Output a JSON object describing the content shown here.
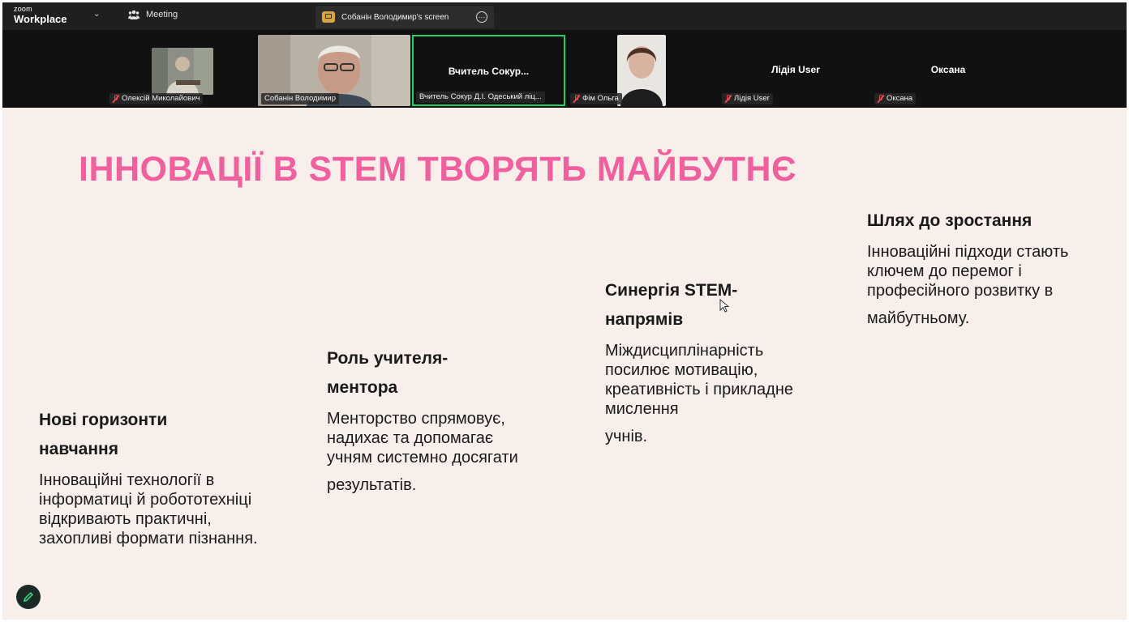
{
  "app": {
    "logo_top": "zoom",
    "logo_bottom": "Workplace",
    "meeting_label": "Meeting",
    "screen_tab_label": "Собанін Володимир's screen"
  },
  "participants": [
    {
      "name": "Олексій Миколайович",
      "muted": true,
      "has_video": true
    },
    {
      "name": "Собанін Володимир",
      "muted": false,
      "has_video": true
    },
    {
      "name": "Вчитель Сокур Д.І. Одеський ліц...",
      "center_name": "Вчитель  Сокур...",
      "muted": false,
      "has_video": false,
      "active_speaker": true
    },
    {
      "name": "Фім Ольга",
      "muted": true,
      "has_video": true
    },
    {
      "name": "Лідія User",
      "center_name": "Лідія User",
      "muted": true,
      "has_video": false
    },
    {
      "name": "Оксана",
      "center_name": "Оксана",
      "muted": true,
      "has_video": false
    }
  ],
  "slide": {
    "title": "ІННОВАЦІЇ В STEM ТВОРЯТЬ МАЙБУТНЄ",
    "columns": [
      {
        "heading_1": "Нові горизонти",
        "heading_2": "навчання",
        "body": "Інноваційні технології в інформатиці й робототехніці відкривають практичні, захопливі формати пізнання."
      },
      {
        "heading_1": "Роль учителя-",
        "heading_2": "ментора",
        "body": "Менторство спрямовує, надихає та допомагає учням системно досягати",
        "body_last": "результатів."
      },
      {
        "heading_1": "Синергія STEM-",
        "heading_2": "напрямів",
        "body": "Міждисциплінарність посилює мотивацію, креативність і прикладне мислення",
        "body_last": "учнів."
      },
      {
        "heading_1": "Шлях до зростання",
        "body": "Інноваційні підходи стають ключем до перемог і професійного розвитку в",
        "body_last": "майбутньому."
      }
    ]
  },
  "colors": {
    "title_pink": "#f0609e",
    "slide_bg": "#f8efeb",
    "active_speaker": "#23d160",
    "muted_red": "#e5484d"
  },
  "icons": [
    "chevron-down-icon",
    "meeting-icon",
    "screen-share-icon",
    "more-icon",
    "mic-off-icon",
    "mouse-cursor-icon",
    "edit-icon"
  ]
}
